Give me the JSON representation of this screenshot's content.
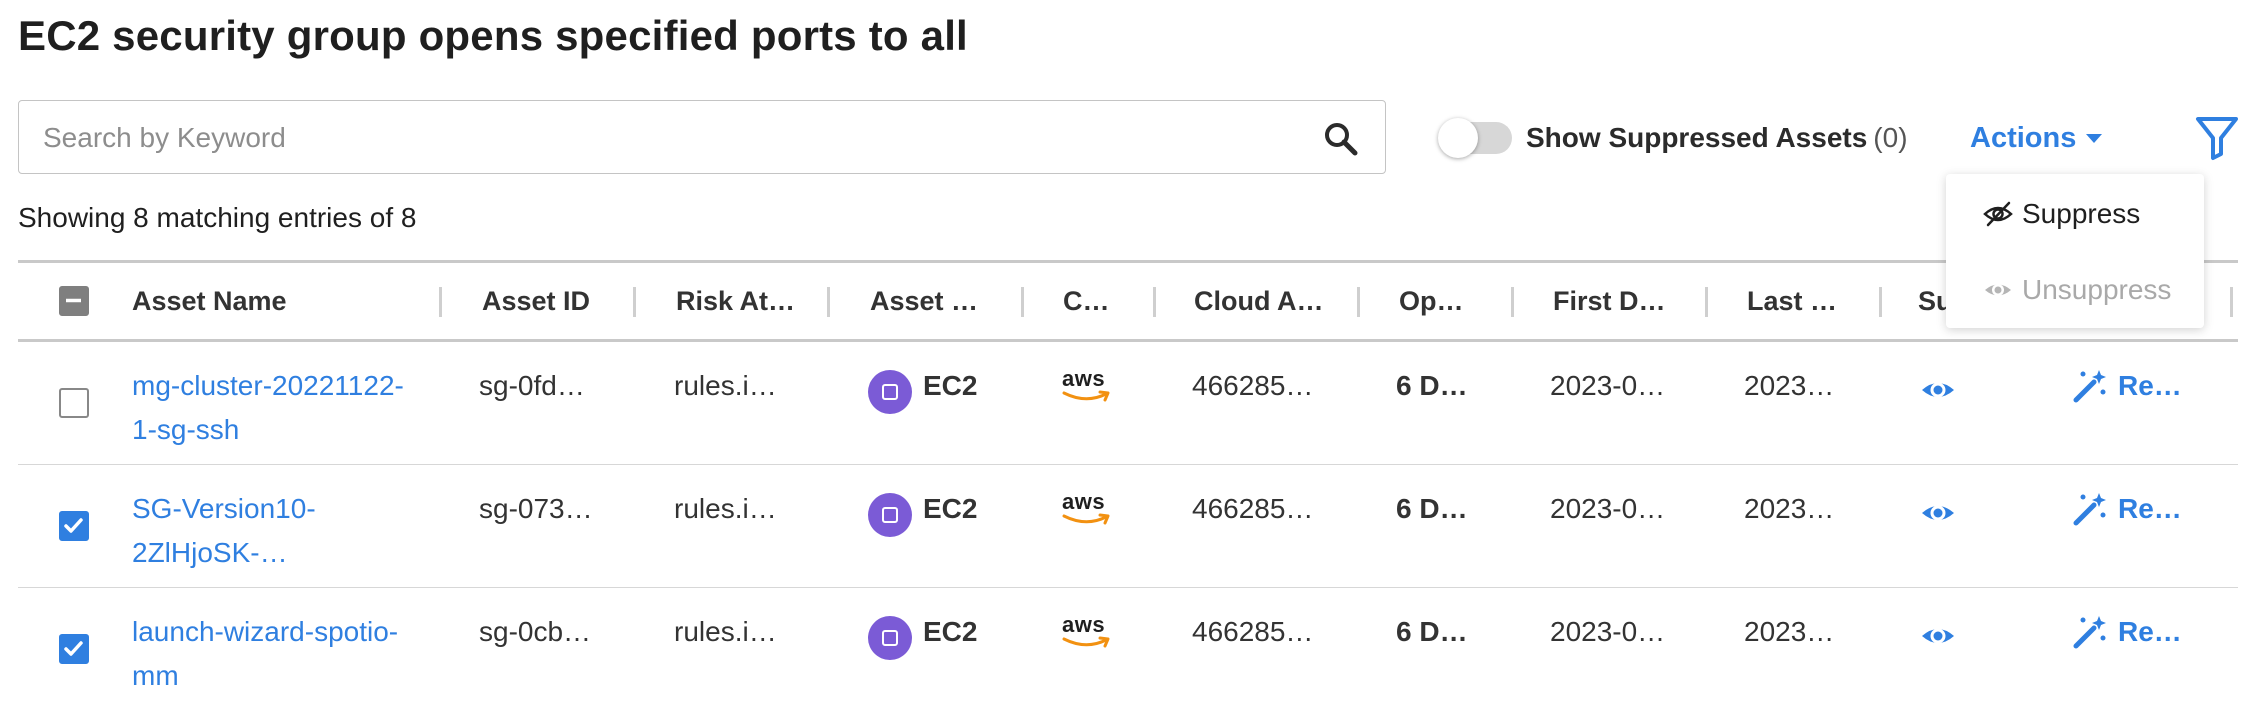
{
  "page": {
    "title": "EC2 security group opens specified ports to all",
    "result_count": "Showing 8 matching entries of 8"
  },
  "search": {
    "placeholder": "Search by Keyword",
    "icon": "search-icon"
  },
  "toggle": {
    "label": "Show Suppressed Assets",
    "count": "(0)",
    "on": false
  },
  "actions": {
    "label": "Actions",
    "menu": [
      {
        "label": "Suppress",
        "icon": "eye-off-icon",
        "enabled": true
      },
      {
        "label": "Unsuppress",
        "icon": "eye-icon",
        "enabled": false
      }
    ]
  },
  "filter": {
    "icon": "filter-icon"
  },
  "colors": {
    "accent": "#2f7fe0",
    "badge": "#7b5bd6",
    "aws_orange": "#f29111",
    "border": "#c9c9c9"
  },
  "table": {
    "columns": [
      "Asset Name",
      "Asset ID",
      "Risk At…",
      "Asset …",
      "C…",
      "Cloud A…",
      "Op…",
      "First D…",
      "Last …",
      "Su"
    ],
    "rows": [
      {
        "checked": false,
        "asset_name": "mg-cluster-20221122-1-sg-ssh",
        "asset_id": "sg-0fd…",
        "risk": "rules.i…",
        "asset_type": "EC2",
        "cloud_provider": "aws",
        "cloud_account": "466285…",
        "open_for": "6 D…",
        "first_detected": "2023-0…",
        "last_detected": "2023…",
        "remediate": "Re…"
      },
      {
        "checked": true,
        "asset_name": "SG-Version10-2ZlHjoSK-…",
        "asset_id": "sg-073…",
        "risk": "rules.i…",
        "asset_type": "EC2",
        "cloud_provider": "aws",
        "cloud_account": "466285…",
        "open_for": "6 D…",
        "first_detected": "2023-0…",
        "last_detected": "2023…",
        "remediate": "Re…"
      },
      {
        "checked": true,
        "asset_name": "launch-wizard-spotio-mm",
        "asset_id": "sg-0cb…",
        "risk": "rules.i…",
        "asset_type": "EC2",
        "cloud_provider": "aws",
        "cloud_account": "466285…",
        "open_for": "6 D…",
        "first_detected": "2023-0…",
        "last_detected": "2023…",
        "remediate": "Re…"
      }
    ]
  }
}
